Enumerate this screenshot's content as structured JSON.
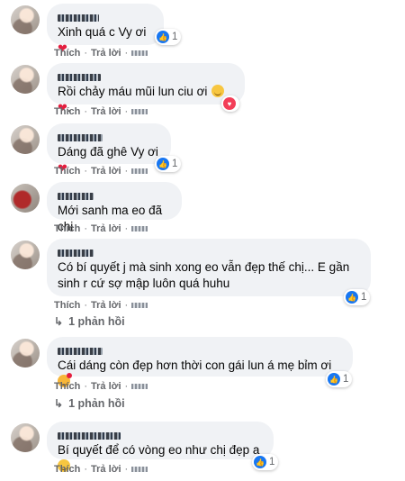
{
  "comments": [
    {
      "text": "Xinh quá c Vy ơi",
      "emoji": "❤",
      "reaction_count": "1",
      "like": "Thích",
      "reply": "Trả lời"
    },
    {
      "text": "Rồi chảy máu mũi lun ciu ơi",
      "emoji": "❤",
      "reaction_count": "",
      "like": "Thích",
      "reply": "Trả lời"
    },
    {
      "text": "Dáng đã ghê Vy ơi",
      "emoji": "❤",
      "reaction_count": "1",
      "like": "Thích",
      "reply": "Trả lời"
    },
    {
      "text": "Mới sanh ma eo đã chi",
      "reaction_count": "",
      "like": "Thích",
      "reply": "Trả lời"
    },
    {
      "text_line1": "Có bí quyết j mà sinh xong eo vẫn đẹp thế chị... E gần",
      "text_line2": "sinh r cứ sợ mập luôn quá huhu",
      "reaction_count": "1",
      "like": "Thích",
      "reply": "Trả lời",
      "replies": "1 phản hồi"
    },
    {
      "text": "Cái dáng còn đẹp hơn thời con gái lun á mẹ bỉm ơi",
      "reaction_count": "1",
      "like": "Thích",
      "reply": "Trả lời",
      "replies": "1 phản hồi"
    },
    {
      "text": "Bí quyết để có vòng eo như chị đẹp a",
      "reaction_count": "1",
      "like": "Thích",
      "reply": "Trả lời"
    }
  ],
  "icons": {
    "like": "thumbs-up-icon",
    "love": "heart-icon",
    "reply_arrow": "reply-arrow-icon"
  },
  "colors": {
    "like_blue": "#1877f2",
    "love_red": "#f33e58",
    "bubble_bg": "#f0f2f5",
    "meta_gray": "#65676b"
  }
}
